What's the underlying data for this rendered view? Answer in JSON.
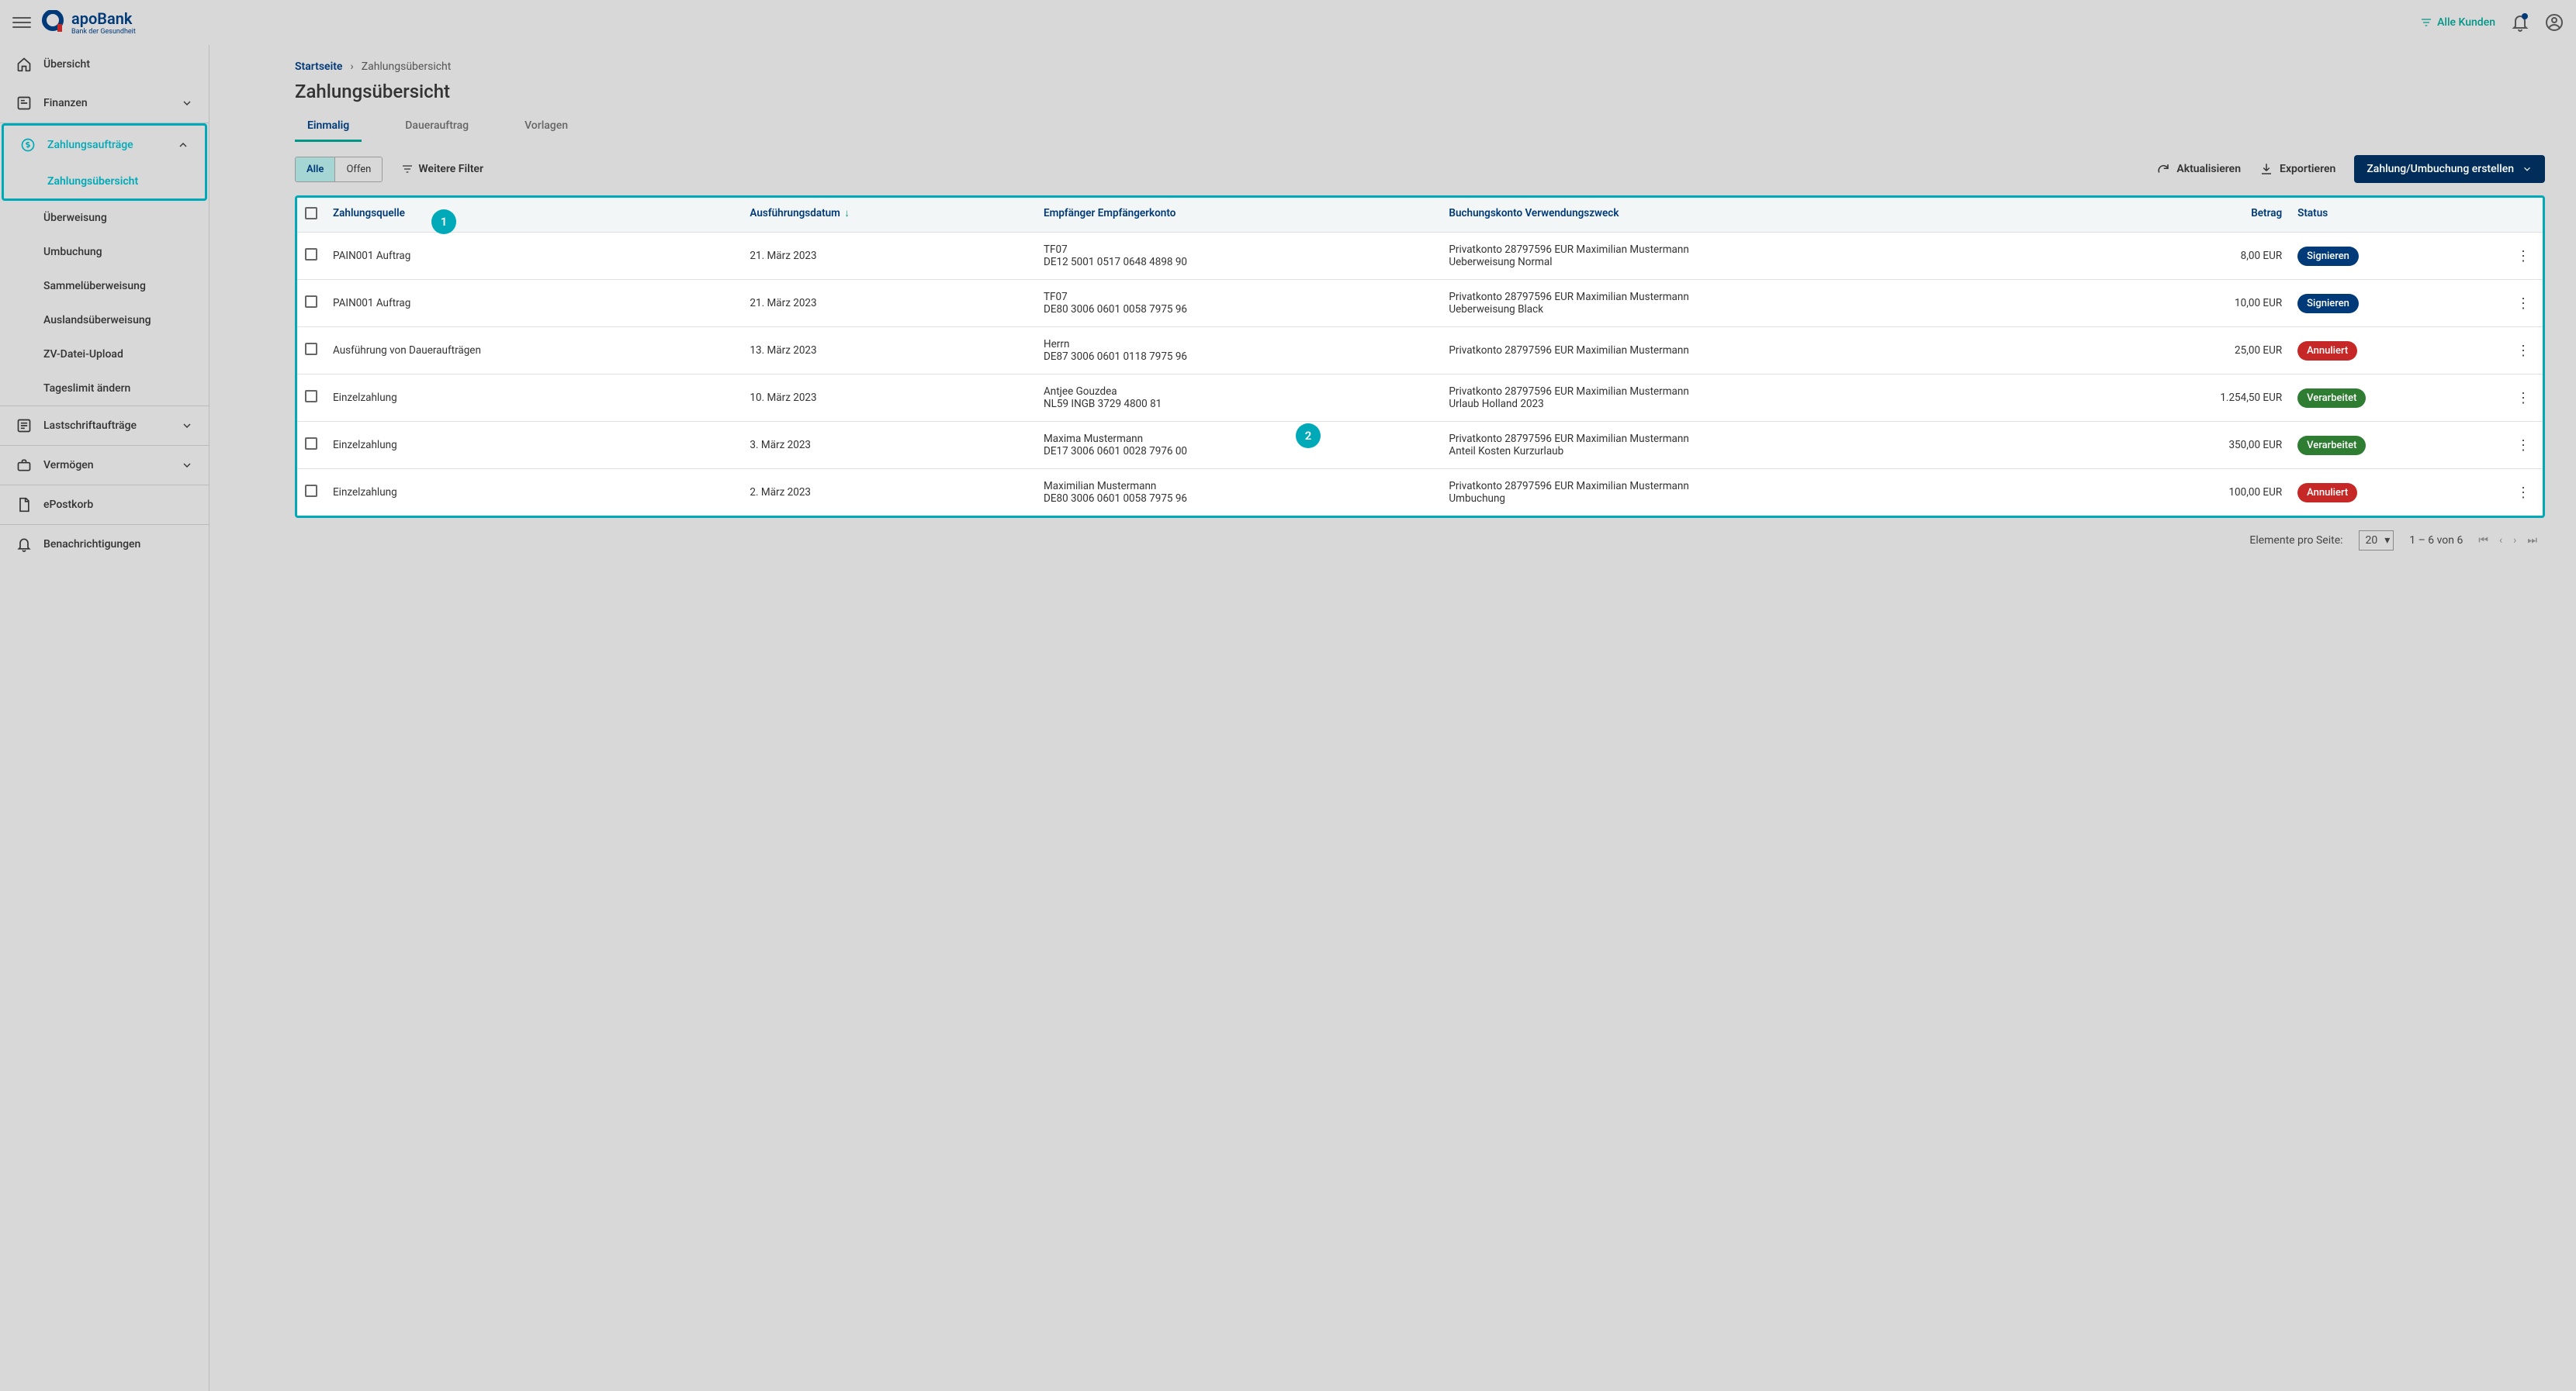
{
  "header": {
    "brand": "apoBank",
    "brand_sub": "Bank der Gesundheit",
    "filter_label": "Alle Kunden"
  },
  "sidebar": {
    "overview": "Übersicht",
    "finanzen": "Finanzen",
    "zahlungsauftraege": "Zahlungsaufträge",
    "sub_items": [
      "Zahlungsübersicht",
      "Überweisung",
      "Umbuchung",
      "Sammelüberweisung",
      "Auslandsüberweisung",
      "ZV-Datei-Upload",
      "Tageslimit ändern"
    ],
    "lastschrift": "Lastschriftaufträge",
    "vermoegen": "Vermögen",
    "epostkorb": "ePostkorb",
    "benachrichtigungen": "Benachrichtigungen"
  },
  "breadcrumb": {
    "home": "Startseite",
    "current": "Zahlungsübersicht"
  },
  "page_title": "Zahlungsübersicht",
  "tabs": {
    "einmalig": "Einmalig",
    "dauer": "Dauerauftrag",
    "vorlagen": "Vorlagen"
  },
  "toolbar": {
    "toggle_all": "Alle",
    "toggle_open": "Offen",
    "more_filters": "Weitere Filter",
    "refresh": "Aktualisieren",
    "export": "Exportieren",
    "create": "Zahlung/Umbuchung erstellen"
  },
  "table": {
    "headers": {
      "source": "Zahlungsquelle",
      "exec_date": "Ausführungsdatum",
      "recipient_l1": "Empfänger",
      "recipient_l2": "Empfängerkonto",
      "booking_l1": "Buchungskonto",
      "booking_l2": "Verwendungszweck",
      "amount": "Betrag",
      "status": "Status"
    },
    "rows": [
      {
        "source": "PAIN001 Auftrag",
        "date": "21. März 2023",
        "recipient": "TF07",
        "recipient_acc": "DE12 5001 0517 0648 4898 90",
        "booking_l1": "Privatkonto 28797596 EUR Maximilian Mustermann",
        "booking_l2": "Ueberweisung Normal",
        "amount": "8,00 EUR",
        "status": "Signieren",
        "status_class": "status-sign"
      },
      {
        "source": "PAIN001 Auftrag",
        "date": "21. März 2023",
        "recipient": "TF07",
        "recipient_acc": "DE80 3006 0601 0058 7975 96",
        "booking_l1": "Privatkonto 28797596 EUR Maximilian Mustermann",
        "booking_l2": "Ueberweisung Black",
        "amount": "10,00 EUR",
        "status": "Signieren",
        "status_class": "status-sign"
      },
      {
        "source": "Ausführung von Daueraufträgen",
        "date": "13. März 2023",
        "recipient": "Herrn",
        "recipient_acc": "DE87 3006 0601 0118 7975 96",
        "booking_l1": "Privatkonto 28797596 EUR Maximilian Mustermann",
        "booking_l2": "",
        "amount": "25,00 EUR",
        "status": "Annuliert",
        "status_class": "status-cancel"
      },
      {
        "source": "Einzelzahlung",
        "date": "10. März 2023",
        "recipient": "Antjee Gouzdea",
        "recipient_acc": "NL59 INGB 3729 4800 81",
        "booking_l1": "Privatkonto 28797596 EUR Maximilian Mustermann",
        "booking_l2": "Urlaub Holland 2023",
        "amount": "1.254,50 EUR",
        "status": "Verarbeitet",
        "status_class": "status-done"
      },
      {
        "source": "Einzelzahlung",
        "date": "3. März 2023",
        "recipient": "Maxima Mustermann",
        "recipient_acc": "DE17 3006 0601 0028 7976 00",
        "booking_l1": "Privatkonto 28797596 EUR Maximilian Mustermann",
        "booking_l2": "Anteil Kosten Kurzurlaub",
        "amount": "350,00 EUR",
        "status": "Verarbeitet",
        "status_class": "status-done"
      },
      {
        "source": "Einzelzahlung",
        "date": "2. März 2023",
        "recipient": "Maximilian Mustermann",
        "recipient_acc": "DE80 3006 0601 0058 7975 96",
        "booking_l1": "Privatkonto 28797596 EUR Maximilian Mustermann",
        "booking_l2": "Umbuchung",
        "amount": "100,00 EUR",
        "status": "Annuliert",
        "status_class": "status-cancel"
      }
    ]
  },
  "pagination": {
    "per_page_label": "Elemente pro Seite:",
    "per_page_value": "20",
    "range": "1 – 6 von 6"
  },
  "markers": {
    "m1": "1",
    "m2": "2"
  }
}
